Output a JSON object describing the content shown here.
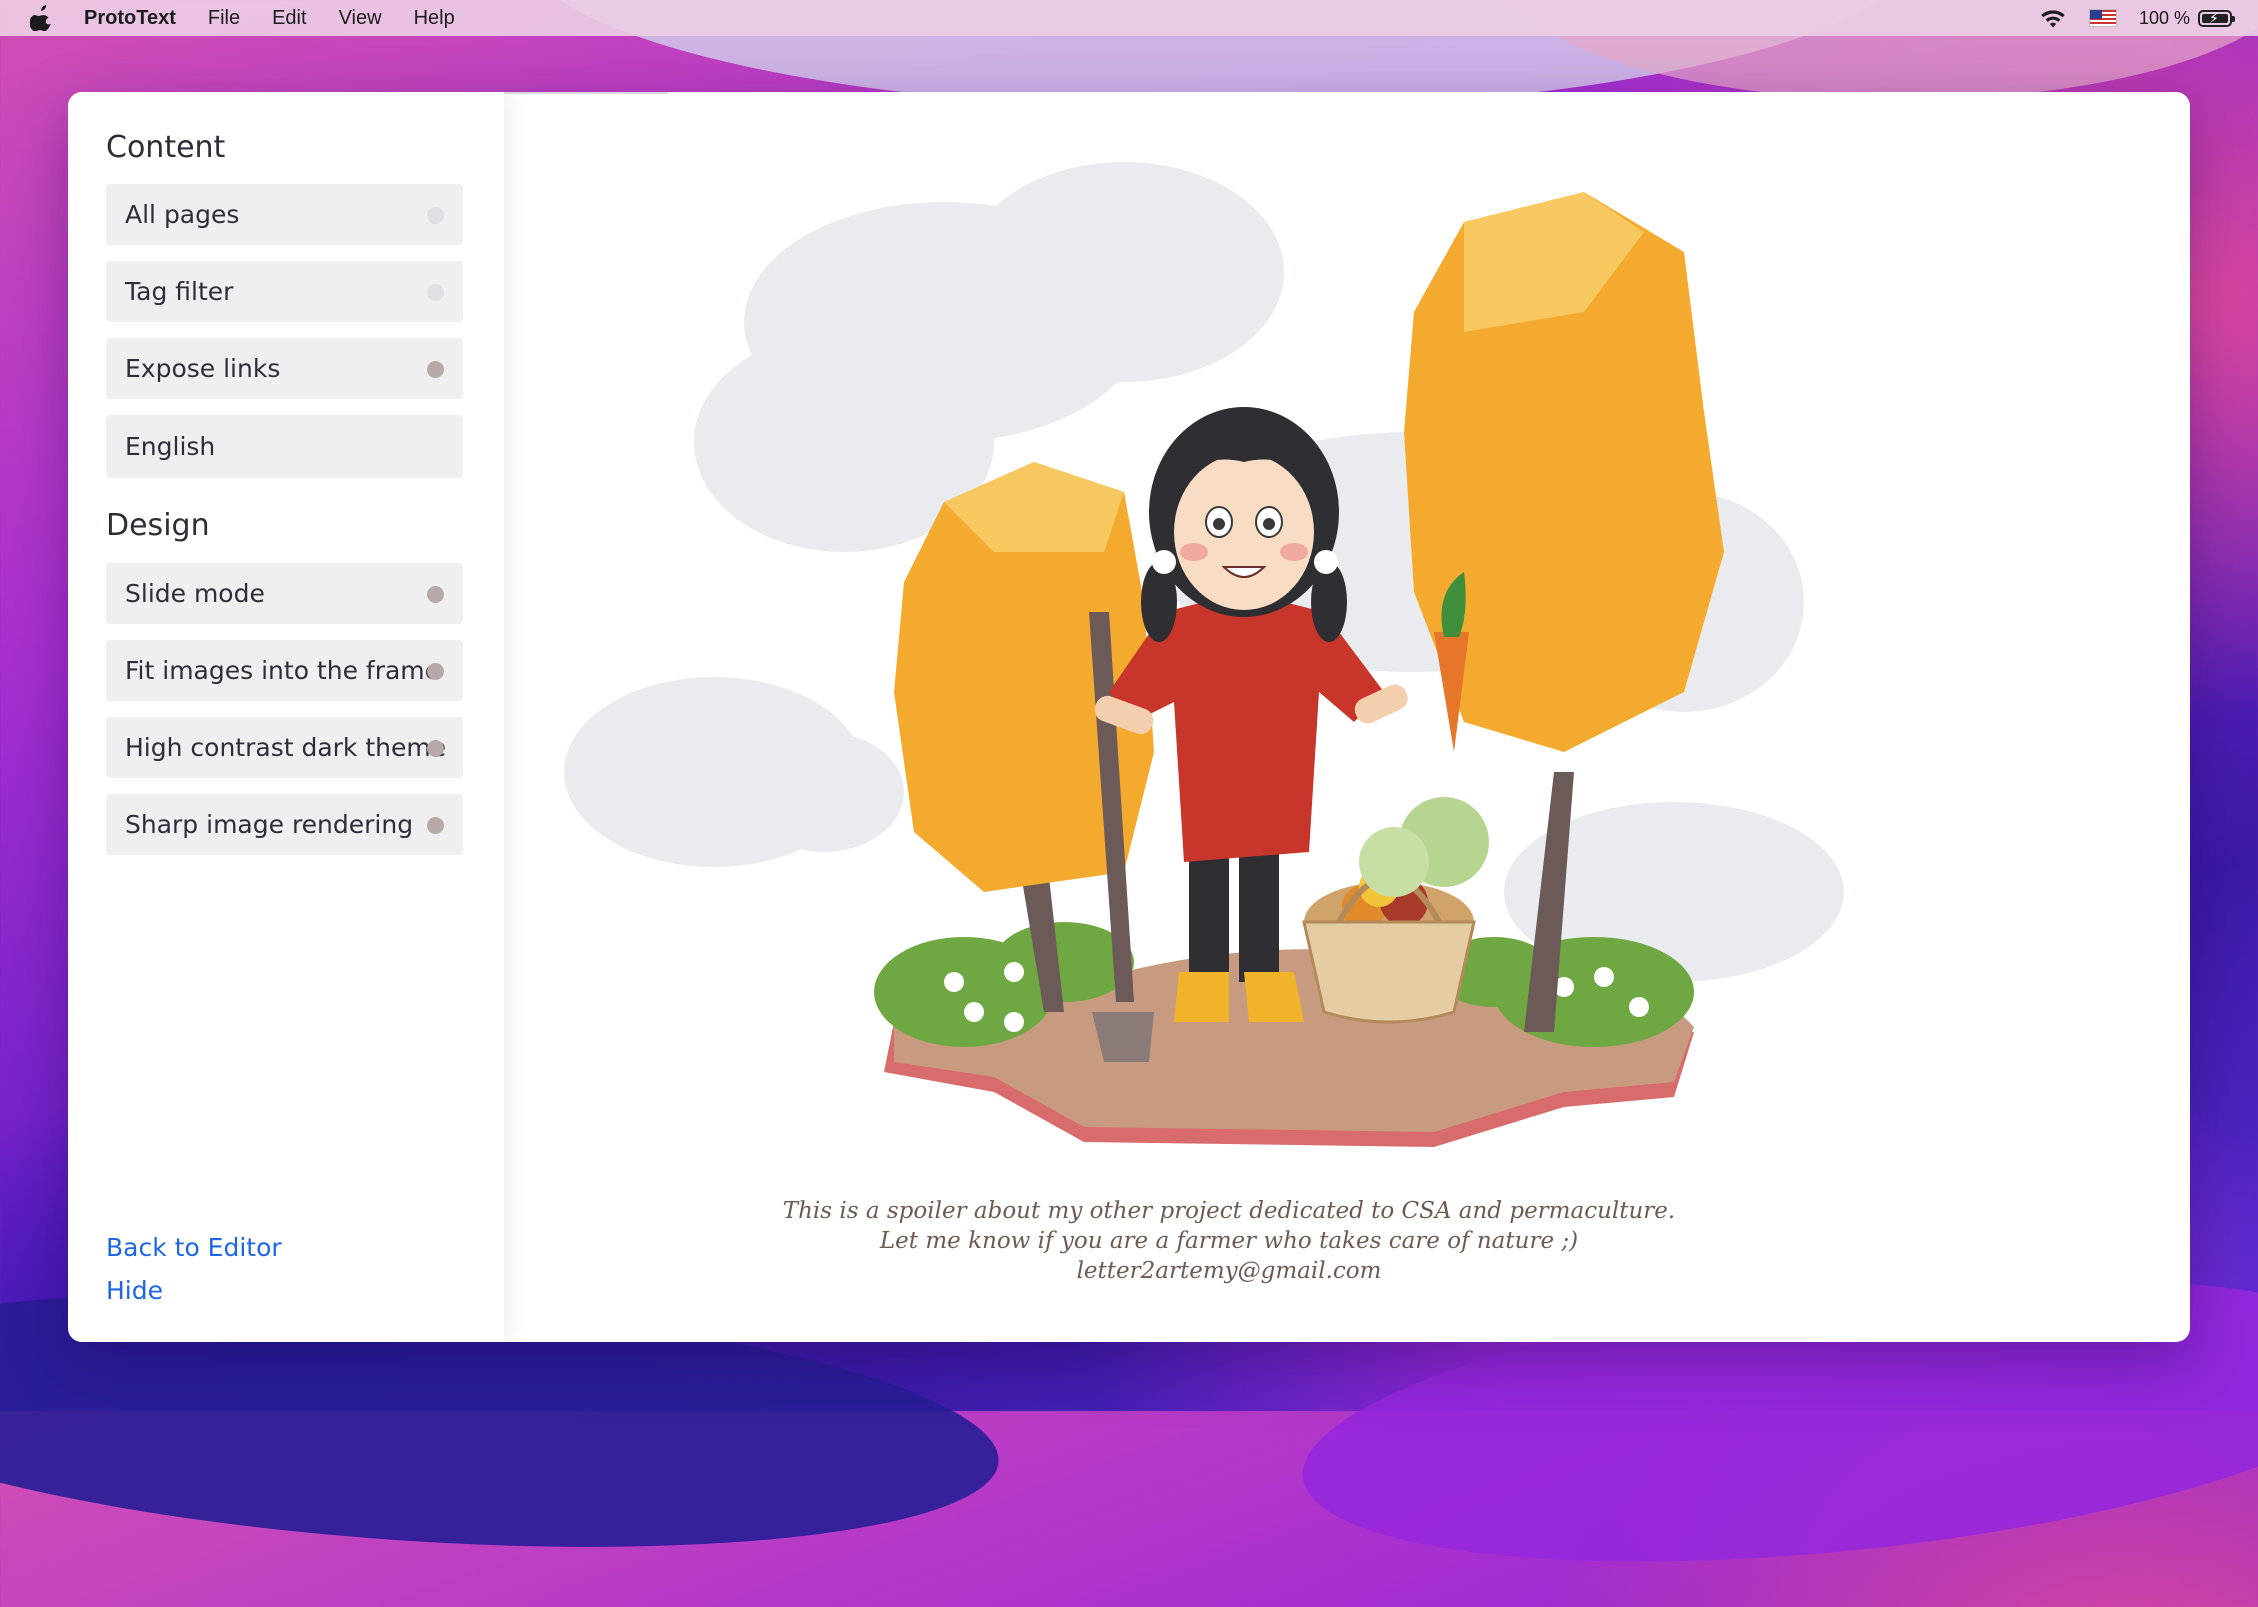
{
  "menubar": {
    "app_name": "ProtoText",
    "items": [
      "File",
      "Edit",
      "View",
      "Help"
    ],
    "battery_text": "100 %",
    "icons": [
      "apple-icon",
      "wifi-icon",
      "us-flag-icon",
      "battery-charging-icon"
    ]
  },
  "sidebar": {
    "content_title": "Content",
    "content_options": [
      {
        "label": "All pages",
        "state": "off"
      },
      {
        "label": "Tag filter",
        "state": "off"
      },
      {
        "label": "Expose links",
        "state": "on"
      },
      {
        "label": "English"
      }
    ],
    "design_title": "Design",
    "design_options": [
      {
        "label": "Slide mode",
        "state": "on"
      },
      {
        "label": "Fit images into the frame",
        "state": "on"
      },
      {
        "label": "High contrast dark theme",
        "state": "on"
      },
      {
        "label": "Sharp image rendering",
        "state": "on"
      }
    ],
    "back_link": "Back to Editor",
    "hide_link": "Hide"
  },
  "main": {
    "caption_line1": "This is a spoiler about my other project dedicated to CSA and permaculture.",
    "caption_line2": "Let me know if you are a farmer who takes care of nature ;)",
    "caption_line3": "letter2artemy@gmail.com"
  },
  "colors": {
    "link": "#1f66e5",
    "toggle_on": "#b7a9a7",
    "toggle_off": "#e0dfe3",
    "caption": "#6d5a52"
  }
}
